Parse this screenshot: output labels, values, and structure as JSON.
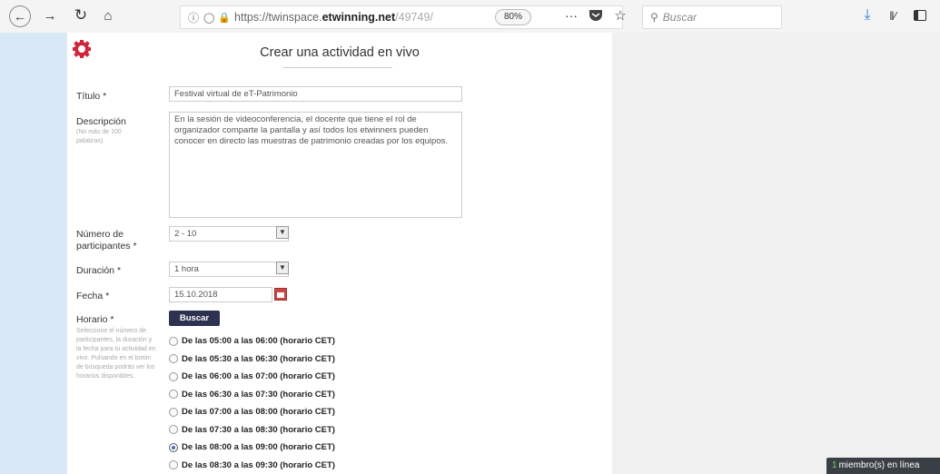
{
  "browser": {
    "url_prefix": "https://twinspace.",
    "url_domain": "etwinning.net",
    "url_rest": "/49749/",
    "zoom": "80%",
    "more_label": "···",
    "search_placeholder": "Buscar"
  },
  "form": {
    "title": "Crear una actividad en vivo",
    "titulo_label": "Título *",
    "titulo_value": "Festival virtual de eT-Patrimonio",
    "descripcion_label": "Descripción",
    "descripcion_hint": "(No más de 100 palabras)",
    "descripcion_value": "En la sesión de videoconferencia, el docente que tiene el rol de organizador comparte la pantalla y así todos los etwinners pueden conocer en directo las muestras de patrimonio creadas por los equipos.",
    "participantes_label": "Número de participantes *",
    "participantes_value": "2 - 10",
    "duracion_label": "Duración *",
    "duracion_value": "1 hora",
    "fecha_label": "Fecha *",
    "fecha_value": "15.10.2018",
    "horario_label": "Horario *",
    "horario_hint": "Seleccione el número de participantes, la duración y la fecha para tu actividad en vivo. Pulsando en el botón de búsqueda podrás ver los horarios disponibles.",
    "buscar_button": "Buscar",
    "slots": [
      {
        "label": "De las 05:00 a las 06:00 (horario CET)",
        "checked": false
      },
      {
        "label": "De las 05:30 a las 06:30 (horario CET)",
        "checked": false
      },
      {
        "label": "De las 06:00 a las 07:00 (horario CET)",
        "checked": false
      },
      {
        "label": "De las 06:30 a las 07:30 (horario CET)",
        "checked": false
      },
      {
        "label": "De las 07:00 a las 08:00 (horario CET)",
        "checked": false
      },
      {
        "label": "De las 07:30 a las 08:30 (horario CET)",
        "checked": false
      },
      {
        "label": "De las 08:00 a las 09:00 (horario CET)",
        "checked": true
      },
      {
        "label": "De las 08:30 a las 09:30 (horario CET)",
        "checked": false
      }
    ]
  },
  "online": {
    "count": "1",
    "label": "miembro(s) en línea"
  },
  "colors": {
    "accent": "#d0263a",
    "button": "#2d3250"
  }
}
